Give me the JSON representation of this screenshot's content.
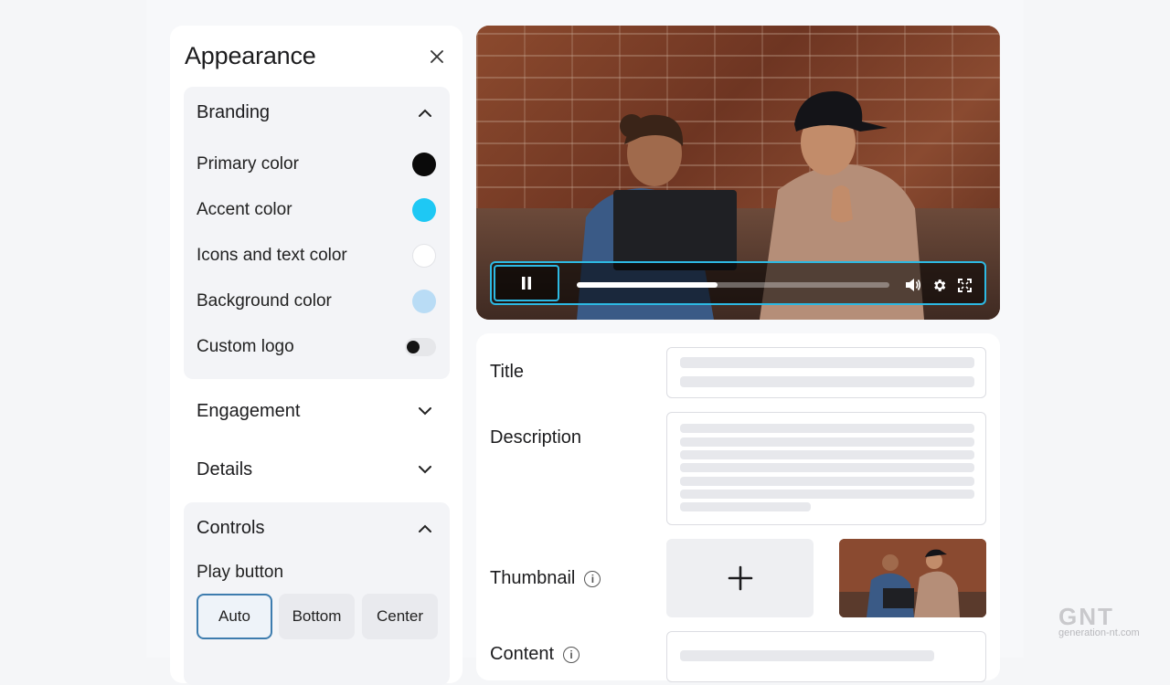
{
  "panel": {
    "title": "Appearance",
    "sections": {
      "branding": {
        "label": "Branding",
        "rows": [
          {
            "label": "Primary color",
            "color": "#0a0a0a"
          },
          {
            "label": "Accent color",
            "color": "#1ec8f4"
          },
          {
            "label": "Icons and text color",
            "color": "#ffffff"
          },
          {
            "label": "Background color",
            "color": "#b9dcf5"
          }
        ],
        "custom_logo_label": "Custom logo",
        "custom_logo_on": false
      },
      "engagement": {
        "label": "Engagement"
      },
      "details": {
        "label": "Details"
      },
      "controls": {
        "label": "Controls",
        "play_button_label": "Play button",
        "options": [
          "Auto",
          "Bottom",
          "Center"
        ],
        "selected": "Auto"
      }
    }
  },
  "player": {
    "progress": 0.45,
    "accent": "#2db9e3",
    "icons": [
      "pause-icon",
      "volume-icon",
      "gear-icon",
      "fullscreen-icon"
    ]
  },
  "form": {
    "title_label": "Title",
    "description_label": "Description",
    "thumbnail_label": "Thumbnail",
    "content_label": "Content"
  },
  "watermark": {
    "main": "GNT",
    "sub": "generation-nt.com"
  }
}
